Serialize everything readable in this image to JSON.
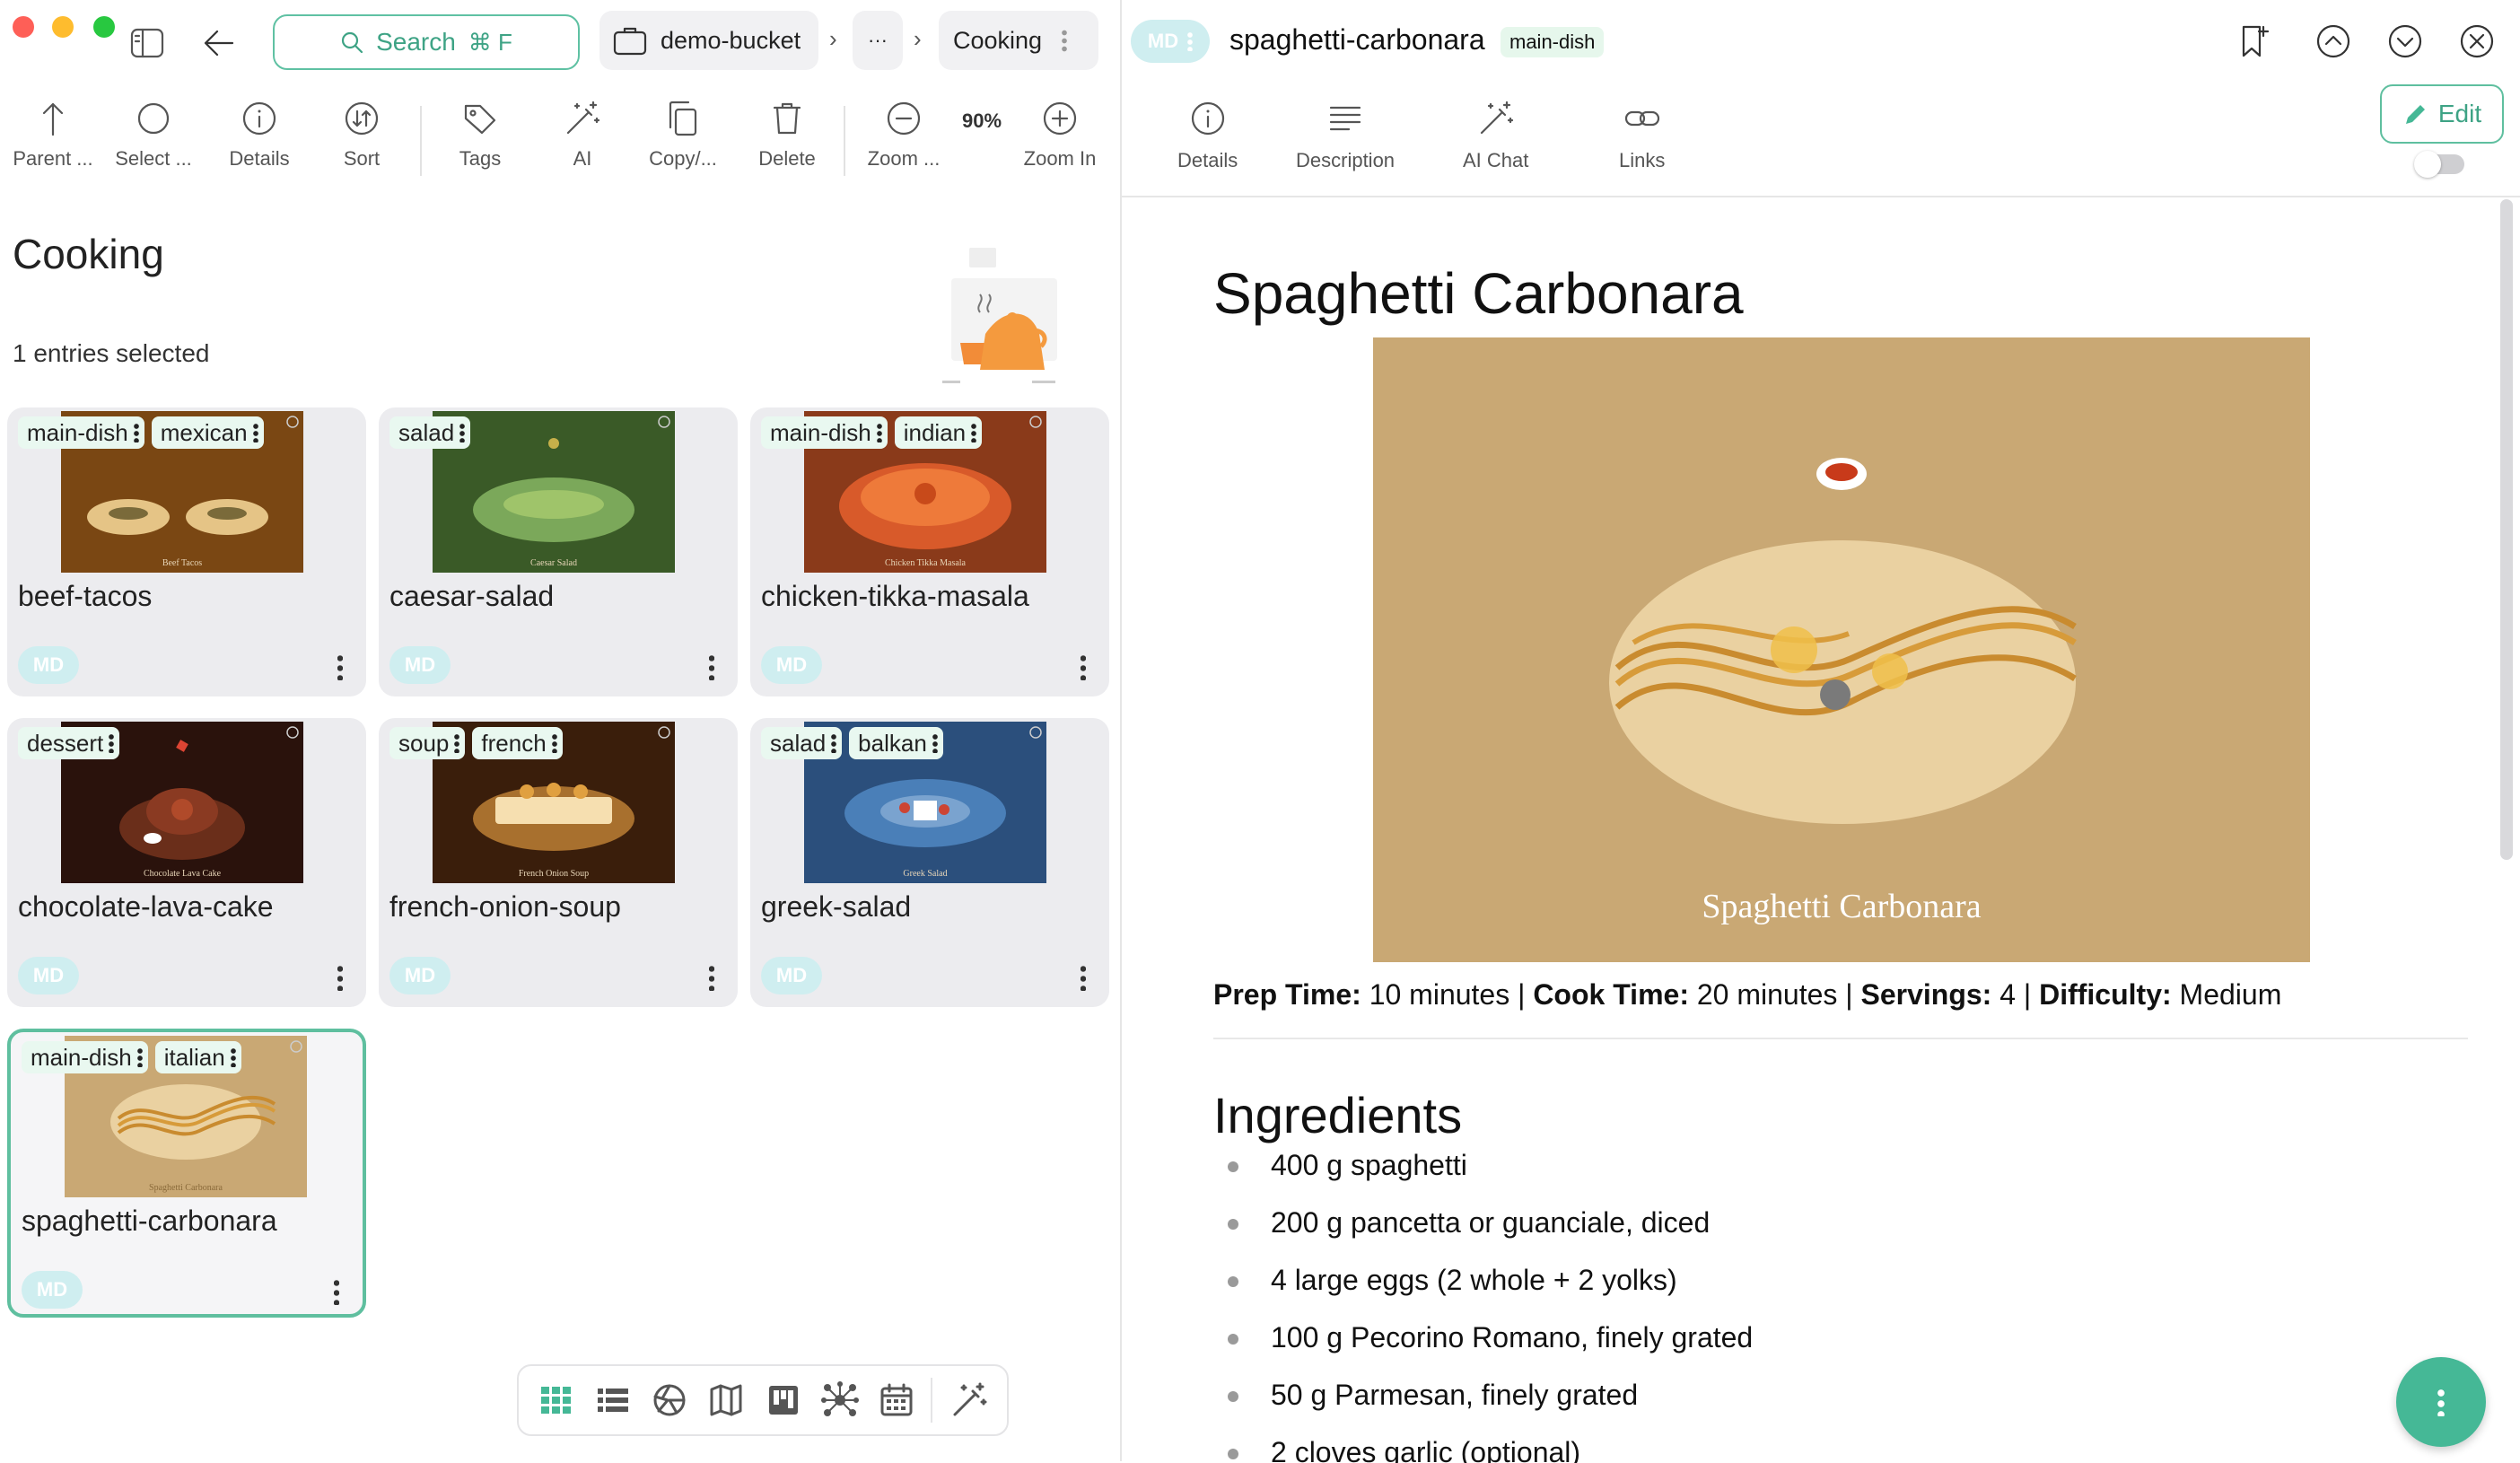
{
  "window": {
    "dot_colors": [
      "#fe5f57",
      "#febc2e",
      "#28c840"
    ]
  },
  "search": {
    "label": "Search",
    "shortcut": "⌘ F"
  },
  "breadcrumb": {
    "location": "demo-bucket",
    "ellipsis": "···",
    "folder": "Cooking"
  },
  "toolbar": {
    "parent": "Parent ...",
    "select": "Select ...",
    "details": "Details",
    "sort": "Sort",
    "tags": "Tags",
    "ai": "AI",
    "copy": "Copy/...",
    "delete": "Delete",
    "zoom_out": "Zoom ...",
    "zoom_level": "90%",
    "zoom_in": "Zoom In"
  },
  "folder": {
    "title": "Cooking",
    "selection_status": "1 entries selected"
  },
  "entries": [
    {
      "name": "beef-tacos",
      "tags": [
        "main-dish",
        "mexican"
      ],
      "badge": "MD",
      "thumb_caption": "Beef Tacos",
      "thumb_bg": "#7a4713"
    },
    {
      "name": "caesar-salad",
      "tags": [
        "salad"
      ],
      "badge": "MD",
      "thumb_caption": "Caesar Salad",
      "thumb_bg": "#3a5a27"
    },
    {
      "name": "chicken-tikka-masala",
      "tags": [
        "main-dish",
        "indian"
      ],
      "badge": "MD",
      "thumb_caption": "Chicken Tikka Masala",
      "thumb_bg": "#8a3a1a"
    },
    {
      "name": "chocolate-lava-cake",
      "tags": [
        "dessert"
      ],
      "badge": "MD",
      "thumb_caption": "Chocolate Lava Cake",
      "thumb_bg": "#2a120c"
    },
    {
      "name": "french-onion-soup",
      "tags": [
        "soup",
        "french"
      ],
      "badge": "MD",
      "thumb_caption": "French Onion Soup",
      "thumb_bg": "#3a1e0b"
    },
    {
      "name": "greek-salad",
      "tags": [
        "salad",
        "balkan"
      ],
      "badge": "MD",
      "thumb_caption": "Greek Salad",
      "thumb_bg": "#2b4f7c"
    },
    {
      "name": "spaghetti-carbonara",
      "tags": [
        "main-dish",
        "italian"
      ],
      "badge": "MD",
      "thumb_caption": "Spaghetti Carbonara",
      "thumb_bg": "#c9a874"
    }
  ],
  "view_modes": [
    "grid-icon",
    "list-icon",
    "gallery-icon",
    "map-icon",
    "kanban-icon",
    "graph-icon",
    "calendar-icon",
    "ai-icon"
  ],
  "preview": {
    "badge": "MD",
    "file_name": "spaghetti-carbonara",
    "tag": "main-dish",
    "tabs": [
      "Details",
      "Description",
      "AI Chat",
      "Links"
    ],
    "edit_label": "Edit",
    "doc_title": "Spaghetti Carbonara",
    "image_caption": "Spaghetti Carbonara",
    "meta": {
      "prep_label": "Prep Time:",
      "prep_value": "10 minutes",
      "cook_label": "Cook Time:",
      "cook_value": "20 minutes",
      "serv_label": "Servings:",
      "serv_value": "4",
      "diff_label": "Difficulty:",
      "diff_value": "Medium",
      "separator": "|"
    },
    "ingredients_heading": "Ingredients",
    "ingredients": [
      "400 g spaghetti",
      "200 g pancetta or guanciale, diced",
      "4 large eggs (2 whole + 2 yolks)",
      "100 g Pecorino Romano, finely grated",
      "50 g Parmesan, finely grated",
      "2 cloves garlic (optional)"
    ]
  },
  "colors": {
    "accent": "#45b896",
    "tag_bg": "#e9f8f0",
    "selected_border": "#5fbf9f"
  }
}
